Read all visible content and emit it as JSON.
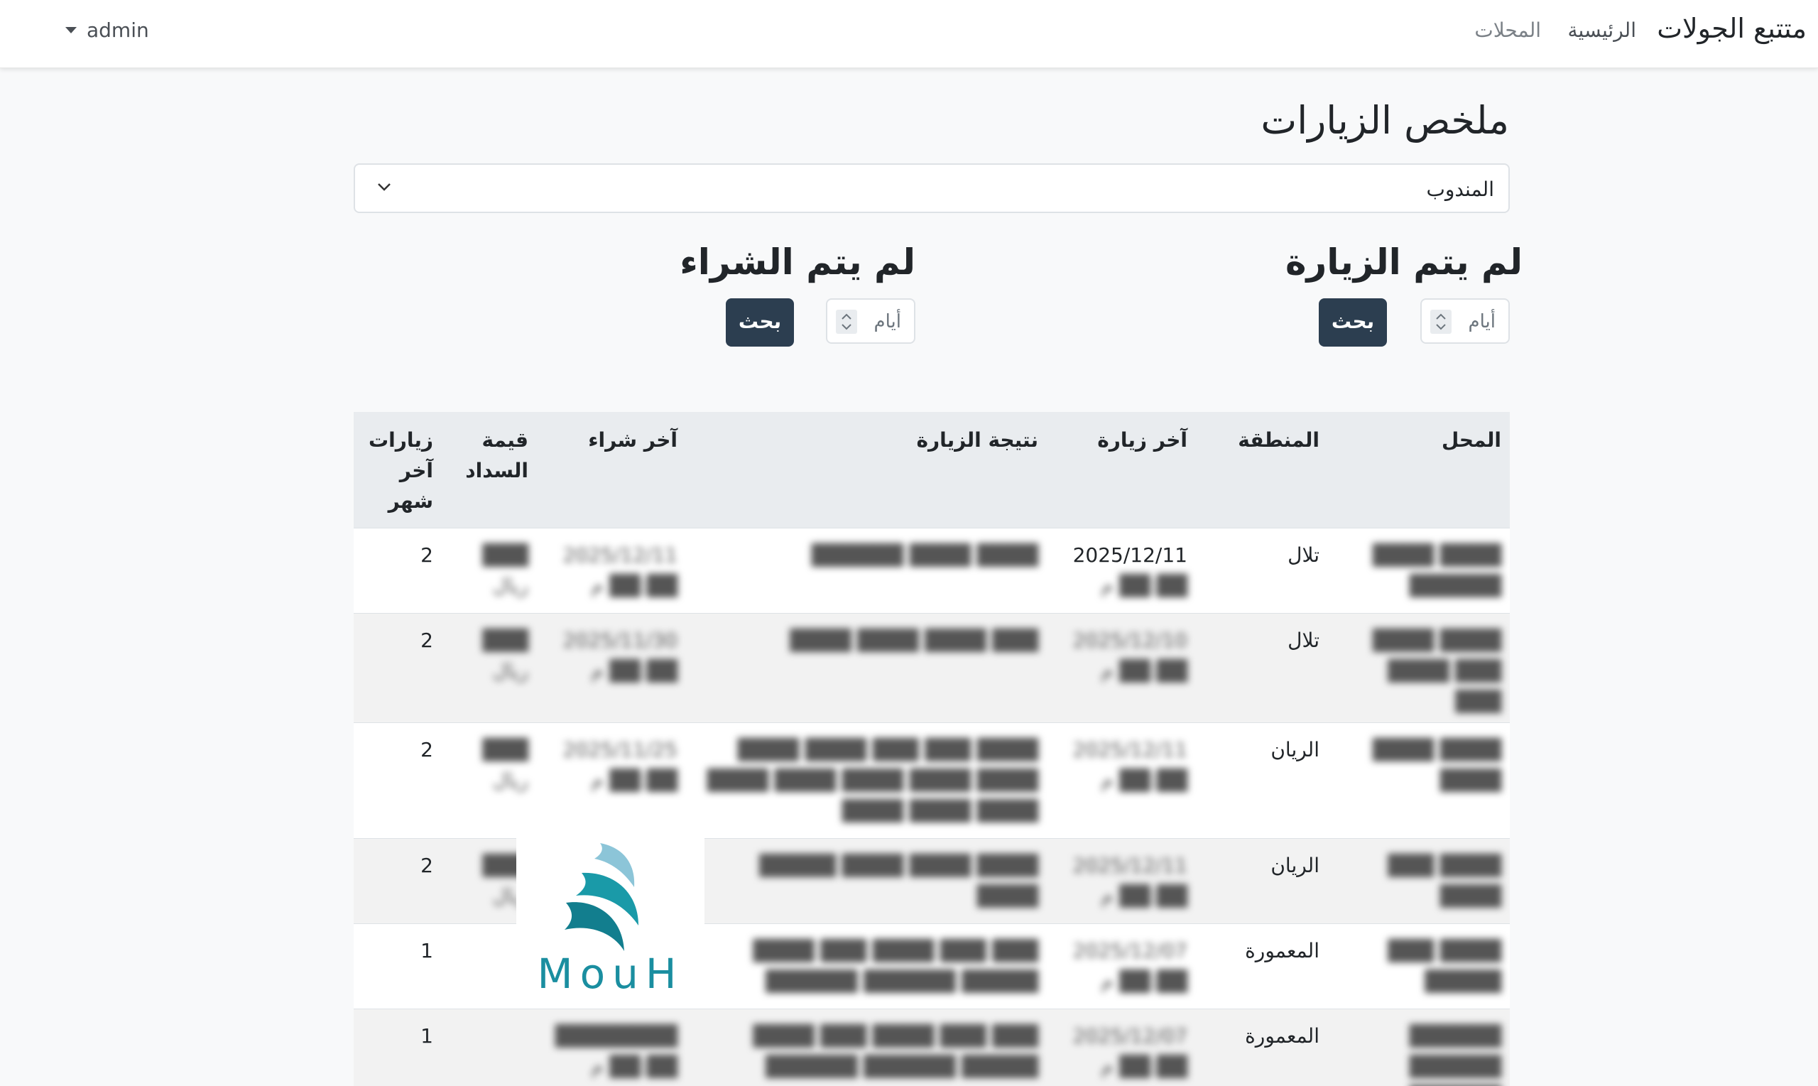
{
  "navbar": {
    "brand": "متتبع الجولات",
    "home": "الرئيسية",
    "shops": "المحلات",
    "user": "admin"
  },
  "page": {
    "title": "ملخص الزيارات",
    "rep_select_value": "المندوب"
  },
  "not_visited": {
    "title": "لم يتم الزيارة",
    "days_placeholder": "أيام",
    "search_label": "بحث"
  },
  "not_purchased": {
    "title": "لم يتم الشراء",
    "days_placeholder": "أيام",
    "search_label": "بحث"
  },
  "table": {
    "headers": [
      "المحل",
      "المنطقة",
      "آخر زيارة",
      "نتيجة الزيارة",
      "آخر شراء",
      "قيمة السداد",
      "زيارات آخر شهر"
    ],
    "rows": [
      {
        "shop": "████ ████ ██████",
        "area": "تلال",
        "last_visit": "2025/12/11",
        "last_visit_time": "██:██ م",
        "result": "████ ████ ██████",
        "last_purchase": "2025/12/11",
        "last_purchase_time": "██:██ م",
        "payment": "███ ريال",
        "visits": "2"
      },
      {
        "shop": "████ ████ ███ ████ ███",
        "area": "تلال",
        "last_visit": "2025/12/10",
        "last_visit_time": "██:██ م",
        "result": "███ ████ ████ ████",
        "last_purchase": "2025/11/30",
        "last_purchase_time": "██:██ م",
        "payment": "███ ريال",
        "visits": "2"
      },
      {
        "shop": "████ ████ ████",
        "area": "الريان",
        "last_visit": "2025/12/11",
        "last_visit_time": "██:██ م",
        "result": "████ ███ ███ ████ ████ ████ ████ ████ ████ ████ ████ ████ ████",
        "last_purchase": "2025/11/25",
        "last_purchase_time": "██:██ م",
        "payment": "███ ريال",
        "visits": "2"
      },
      {
        "shop": "████ ███ ████",
        "area": "الريان",
        "last_visit": "2025/12/11",
        "last_visit_time": "██:██ م",
        "result": "████ ████ ████ █████ ████",
        "last_purchase": "",
        "last_purchase_time": "",
        "payment": "███ ريال",
        "visits": "2"
      },
      {
        "shop": "████ ███ █████",
        "area": "المعمورة",
        "last_visit": "2025/12/07",
        "last_visit_time": "██:██ م",
        "result": "███ ███ ████ ███ ████ █████ ██████ ██████",
        "last_purchase": "",
        "last_purchase_time": "",
        "payment": "",
        "visits": "1"
      },
      {
        "shop": "██████ ██████ ██████",
        "area": "المعمورة",
        "last_visit": "2025/12/07",
        "last_visit_time": "██:██ م",
        "result": "███ ███ ████ ███ ████ █████ ██████ ██████",
        "last_purchase": "████████",
        "last_purchase_time": "██:██ م",
        "payment": "",
        "visits": "1"
      }
    ]
  },
  "logo": {
    "text": "MouH",
    "color": "#1a8ea0"
  },
  "colors": {
    "button_bg": "#2c3e50",
    "header_bg": "#e9ecef",
    "page_bg": "#f8f9fa"
  }
}
